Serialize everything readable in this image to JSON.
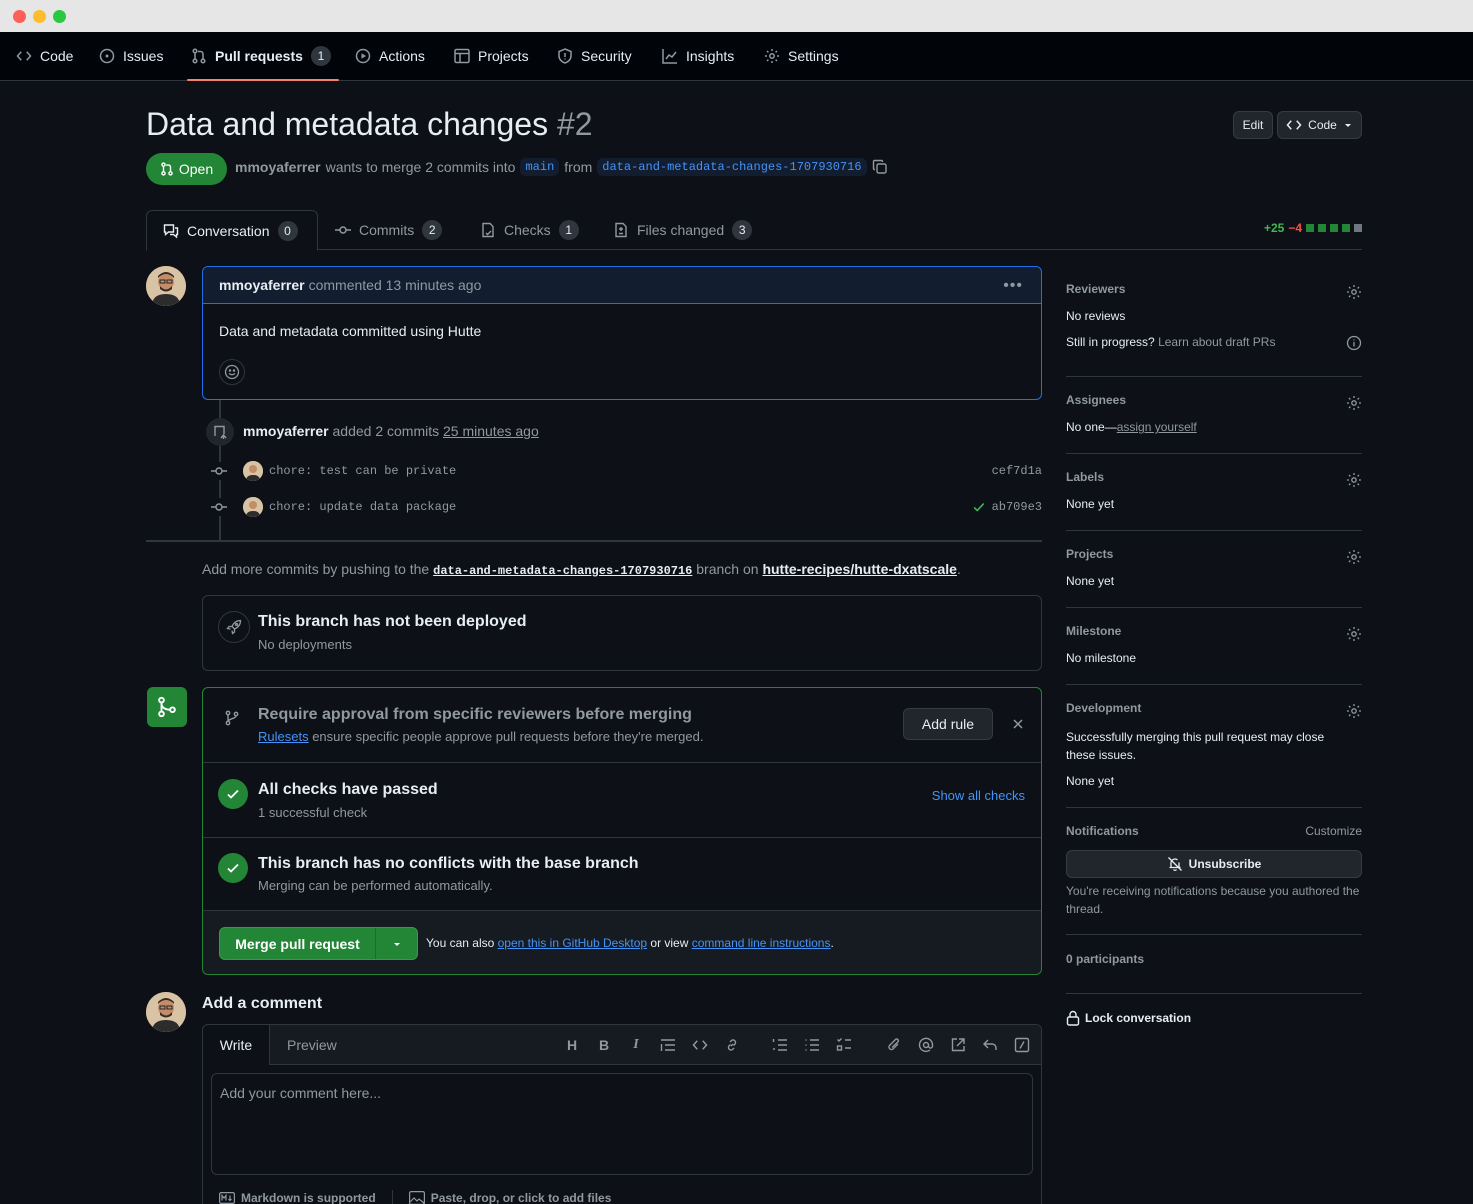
{
  "nav": {
    "code": "Code",
    "issues": "Issues",
    "pull_requests": "Pull requests",
    "pull_requests_count": "1",
    "actions": "Actions",
    "projects": "Projects",
    "security": "Security",
    "insights": "Insights",
    "settings": "Settings"
  },
  "pr": {
    "title": "Data and metadata changes",
    "number": "#2",
    "state": "Open",
    "author": "mmoyaferrer",
    "merge_text": "wants to merge 2 commits into",
    "base_branch": "main",
    "from_text": "from",
    "head_branch": "data-and-metadata-changes-1707930716",
    "edit_label": "Edit",
    "code_label": "Code"
  },
  "tabs": {
    "conversation": "Conversation",
    "conversation_count": "0",
    "commits": "Commits",
    "commits_count": "2",
    "checks": "Checks",
    "checks_count": "1",
    "files_changed": "Files changed",
    "files_changed_count": "3",
    "additions": "+25",
    "deletions": "−4"
  },
  "comment": {
    "author": "mmoyaferrer",
    "meta": "commented 13 minutes ago",
    "body": "Data and metadata committed using Hutte"
  },
  "timeline": {
    "author": "mmoyaferrer",
    "event": "added 2 commits",
    "time": "25 minutes ago",
    "commits": [
      {
        "message": "chore: test can be private",
        "sha": "cef7d1a"
      },
      {
        "message": "chore: update data package",
        "sha": "ab709e3"
      }
    ]
  },
  "push_hint": {
    "prefix": "Add more commits by pushing to the",
    "branch": "data-and-metadata-changes-1707930716",
    "middle": "branch on",
    "repo": "hutte-recipes/hutte-dxatscale",
    "suffix": "."
  },
  "deploy": {
    "title": "This branch has not been deployed",
    "subtitle": "No deployments"
  },
  "merge": {
    "rule_title": "Require approval from specific reviewers before merging",
    "rule_link": "Rulesets",
    "rule_sub": "ensure specific people approve pull requests before they're merged.",
    "add_rule": "Add rule",
    "checks_title": "All checks have passed",
    "checks_sub": "1 successful check",
    "show_checks": "Show all checks",
    "conflicts_title": "This branch has no conflicts with the base branch",
    "conflicts_sub": "Merging can be performed automatically.",
    "merge_button": "Merge pull request",
    "note_prefix": "You can also",
    "note_link1": "open this in GitHub Desktop",
    "note_middle": "or view",
    "note_link2": "command line instructions",
    "note_suffix": "."
  },
  "add_comment": {
    "title": "Add a comment",
    "write_tab": "Write",
    "preview_tab": "Preview",
    "placeholder": "Add your comment here...",
    "markdown": "Markdown is supported",
    "attach": "Paste, drop, or click to add files"
  },
  "sidebar": {
    "reviewers_h": "Reviewers",
    "reviewers_v": "No reviews",
    "draft_q": "Still in progress?",
    "draft_link": "Learn about draft PRs",
    "assignees_h": "Assignees",
    "assignees_v": "No one—",
    "assign_link": "assign yourself",
    "labels_h": "Labels",
    "labels_v": "None yet",
    "projects_h": "Projects",
    "projects_v": "None yet",
    "milestone_h": "Milestone",
    "milestone_v": "No milestone",
    "development_h": "Development",
    "development_desc": "Successfully merging this pull request may close these issues.",
    "development_v": "None yet",
    "notifications_h": "Notifications",
    "customize": "Customize",
    "unsubscribe": "Unsubscribe",
    "notif_reason": "You're receiving notifications because you authored the thread.",
    "participants": "0 participants",
    "lock": "Lock conversation"
  },
  "colors": {
    "accent": "#4493f8",
    "success": "#238636",
    "danger": "#f85149",
    "nav_underline": "#f78166"
  }
}
